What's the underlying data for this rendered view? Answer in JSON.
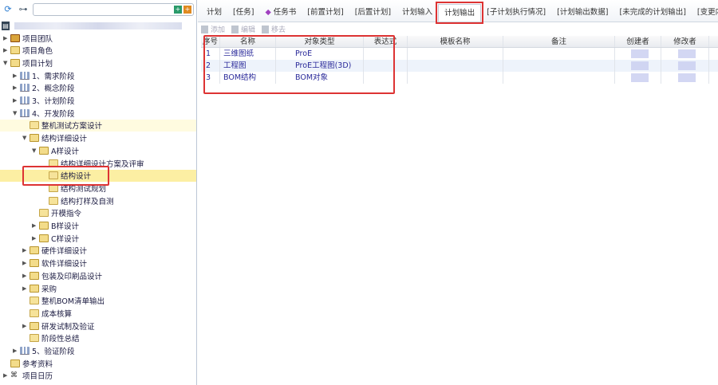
{
  "tree": {
    "search_placeholder": "",
    "items": [
      {
        "label": "项目团队",
        "level": 0,
        "arrow": "right",
        "icon": "gift"
      },
      {
        "label": "项目角色",
        "level": 0,
        "arrow": "right",
        "icon": "folder"
      },
      {
        "label": "项目计划",
        "level": 0,
        "arrow": "down",
        "icon": "folder-open"
      },
      {
        "label": "1、需求阶段",
        "level": 1,
        "arrow": "right",
        "icon": "stage"
      },
      {
        "label": "2、概念阶段",
        "level": 1,
        "arrow": "right",
        "icon": "stage"
      },
      {
        "label": "3、计划阶段",
        "level": 1,
        "arrow": "right",
        "icon": "stage"
      },
      {
        "label": "4、开发阶段",
        "level": 1,
        "arrow": "down",
        "icon": "stage"
      },
      {
        "label": "整机测试方案设计",
        "level": 2,
        "arrow": "",
        "icon": "doc",
        "state": "hover"
      },
      {
        "label": "结构详细设计",
        "level": 2,
        "arrow": "down",
        "icon": "folder"
      },
      {
        "label": "A样设计",
        "level": 3,
        "arrow": "down",
        "icon": "folder"
      },
      {
        "label": "结构详细设计方案及评审",
        "level": 4,
        "arrow": "",
        "icon": "doc"
      },
      {
        "label": "结构设计",
        "level": 4,
        "arrow": "",
        "icon": "doc",
        "state": "selected"
      },
      {
        "label": "结构测试规划",
        "level": 4,
        "arrow": "",
        "icon": "doc"
      },
      {
        "label": "结构打样及自测",
        "level": 4,
        "arrow": "",
        "icon": "doc"
      },
      {
        "label": "开模指令",
        "level": 3,
        "arrow": "",
        "icon": "doc"
      },
      {
        "label": "B样设计",
        "level": 3,
        "arrow": "right",
        "icon": "folder"
      },
      {
        "label": "C样设计",
        "level": 3,
        "arrow": "right",
        "icon": "folder"
      },
      {
        "label": "硬件详细设计",
        "level": 2,
        "arrow": "right",
        "icon": "folder"
      },
      {
        "label": "软件详细设计",
        "level": 2,
        "arrow": "right",
        "icon": "folder"
      },
      {
        "label": "包装及印刷品设计",
        "level": 2,
        "arrow": "right",
        "icon": "folder"
      },
      {
        "label": "采购",
        "level": 2,
        "arrow": "right",
        "icon": "folder"
      },
      {
        "label": "整机BOM清单输出",
        "level": 2,
        "arrow": "",
        "icon": "doc"
      },
      {
        "label": "成本核算",
        "level": 2,
        "arrow": "",
        "icon": "doc"
      },
      {
        "label": "研发试制及验证",
        "level": 2,
        "arrow": "right",
        "icon": "folder"
      },
      {
        "label": "阶段性总结",
        "level": 2,
        "arrow": "",
        "icon": "doc"
      },
      {
        "label": "5、验证阶段",
        "level": 1,
        "arrow": "right",
        "icon": "stage"
      },
      {
        "label": "参考资料",
        "level": 0,
        "arrow": "",
        "icon": "folder"
      },
      {
        "label": "项目日历",
        "level": 0,
        "arrow": "right",
        "icon": "calendar"
      }
    ]
  },
  "tabs": [
    {
      "label": "计划"
    },
    {
      "label": "[任务]"
    },
    {
      "label": "任务书",
      "icon": "book"
    },
    {
      "label": "[前置计划]"
    },
    {
      "label": "[后置计划]"
    },
    {
      "label": "计划输入"
    },
    {
      "label": "计划输出",
      "active": true
    },
    {
      "label": "[子计划执行情况]"
    },
    {
      "label": "[计划输出数据]"
    },
    {
      "label": "[未完成的计划输出]"
    },
    {
      "label": "[变更内容]"
    }
  ],
  "toolbar": {
    "add": "添加",
    "edit": "编辑",
    "remove": "移去"
  },
  "grid": {
    "columns": [
      "序号",
      "名称",
      "对象类型",
      "表达式",
      "模板名称",
      "备注",
      "创建者",
      "修改者"
    ],
    "rows": [
      {
        "no": "1",
        "name": "三维图纸",
        "type": "ProE"
      },
      {
        "no": "2",
        "name": "工程图",
        "type": "ProE工程图(3D)"
      },
      {
        "no": "3",
        "name": "BOM结构",
        "type": "BOM对象"
      }
    ]
  },
  "colors": {
    "highlight": "#dd3333",
    "selected_row": "#fcefa3"
  }
}
